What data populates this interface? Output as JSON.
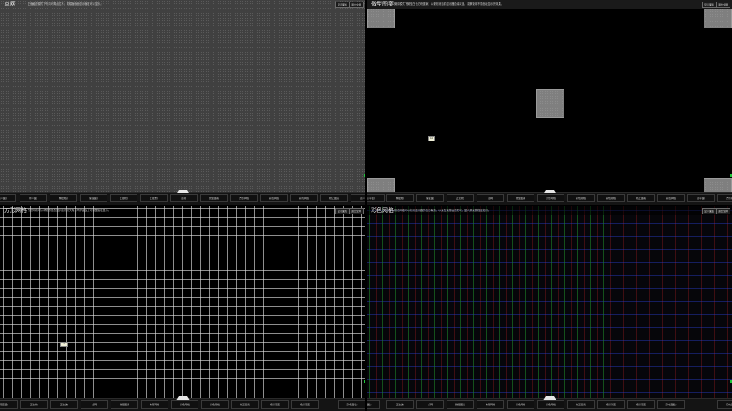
{
  "panels": {
    "dot": {
      "title": "点网",
      "desc": "正面触控模式下方向可调点位不，同模面面面显示面板可以显示。",
      "btn_a": "显示面板",
      "btn_b": "退出全屏",
      "toolbar": [
        "点平面)",
        "水平面)",
        "棋盘格)",
        "渐变面)",
        "正弦线)",
        "正弦波)",
        "点网",
        "微型图案",
        "方形网格",
        "彩色网格",
        "彩色网格",
        "校正图案",
        "点平面)"
      ]
    },
    "pattern": {
      "title": "微型图案",
      "desc": "微调模式下微型白色方块图案，以便检测当前显示器边缘灰度，观察使用不同面板显示的效果。",
      "btn_a": "显示面板",
      "btn_b": "退出全屏",
      "cursor_label": "A1",
      "toolbar": [
        "点平面)",
        "棋盘格)",
        "渐变面)",
        "正弦线)",
        "点网",
        "微型图案",
        "方形网格",
        "彩色网格",
        "彩色网格",
        "校正图案",
        "彩色网格",
        "点平面)",
        "方形网格"
      ]
    },
    "square": {
      "title": "方形网格",
      "desc": "方形网格可以帮助您检查显示器几何失真，同样面板上可调整面板显示。",
      "btn_a": "显示面板",
      "btn_b": "退出全屏",
      "cursor_label": "A1",
      "toolbar": [
        "渐变面)",
        "正弦线)",
        "正弦波)",
        "点网",
        "微型图案",
        "方形网格",
        "彩色网格",
        "彩色网格",
        "校正图案",
        "色彩渐变",
        "色彩渐变",
        "杂色面板)"
      ]
    },
    "color": {
      "title": "彩色网格",
      "desc": "彩色网格可以检测显示器的色彩聚焦，以及在聚焦后的形状，显示其聚焦程度如何。",
      "btn_a": "显示面板",
      "btn_b": "退出全屏",
      "toolbar": [
        "杂色面板)",
        "正弦波)",
        "点网",
        "微型图案",
        "方形网格",
        "彩色网格",
        "彩色网格",
        "校正图案",
        "色彩渐变",
        "色彩渐变",
        "杂色面板)",
        "杂色面板"
      ]
    }
  }
}
